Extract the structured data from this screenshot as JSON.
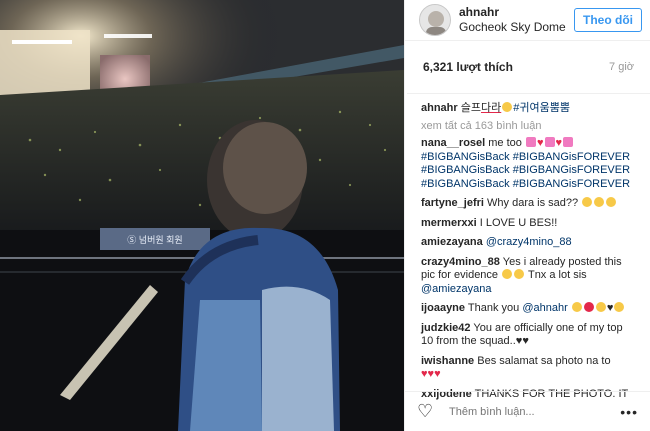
{
  "post": {
    "username": "ahnahr",
    "location": "Gocheok Sky Dome",
    "follow_label": "Theo dõi",
    "likes": "6,321 lượt thích",
    "time": "7 giờ"
  },
  "caption": {
    "username": "ahnahr",
    "text_korean_1": "슬프",
    "text_korean_2": "다라",
    "hashtag": "#귀여움뿜뿜",
    "view_all": "xem tất cả 163 bình luận"
  },
  "comments": [
    {
      "user": "nana__rosel",
      "text": "me too"
    },
    {
      "user": "",
      "text": "#BIGBANGisBack #BIGBANGisFOREVER"
    },
    {
      "user": "",
      "text": "#BIGBANGisBack #BIGBANGisFOREVER"
    },
    {
      "user": "",
      "text": "#BIGBANGisBack #BIGBANGisFOREVER"
    },
    {
      "user": "fartyne_jefri",
      "text": "Why dara is sad??"
    },
    {
      "user": "mermerxxi",
      "text": "I LOVE U BES!!"
    },
    {
      "user": "amiezayana",
      "text": "@crazy4mino_88"
    },
    {
      "user": "crazy4mino_88",
      "text": "Yes i already posted this pic for evidence",
      "text2": "Tnx a lot sis",
      "mention": "@amiezayana"
    },
    {
      "user": "ijoaayne",
      "text": "Thank you",
      "mention": "@ahnahr"
    },
    {
      "user": "judzkie42",
      "text": "You are officially one of my top 10 from the squad.."
    },
    {
      "user": "iwishanne",
      "text": "Bes salamat sa photo na to"
    },
    {
      "user": "xxijodene",
      "text": "THANKS FOR THE PHOTO. IT"
    }
  ],
  "footer": {
    "placeholder": "Thêm bình luận...",
    "more": "•••"
  },
  "photo": {
    "banner_text": "Ⓢ 넘버원 회원"
  },
  "colors": {
    "accent": "#3897f0",
    "link": "#003569",
    "muted": "#999999",
    "heart": "#e3284b"
  }
}
